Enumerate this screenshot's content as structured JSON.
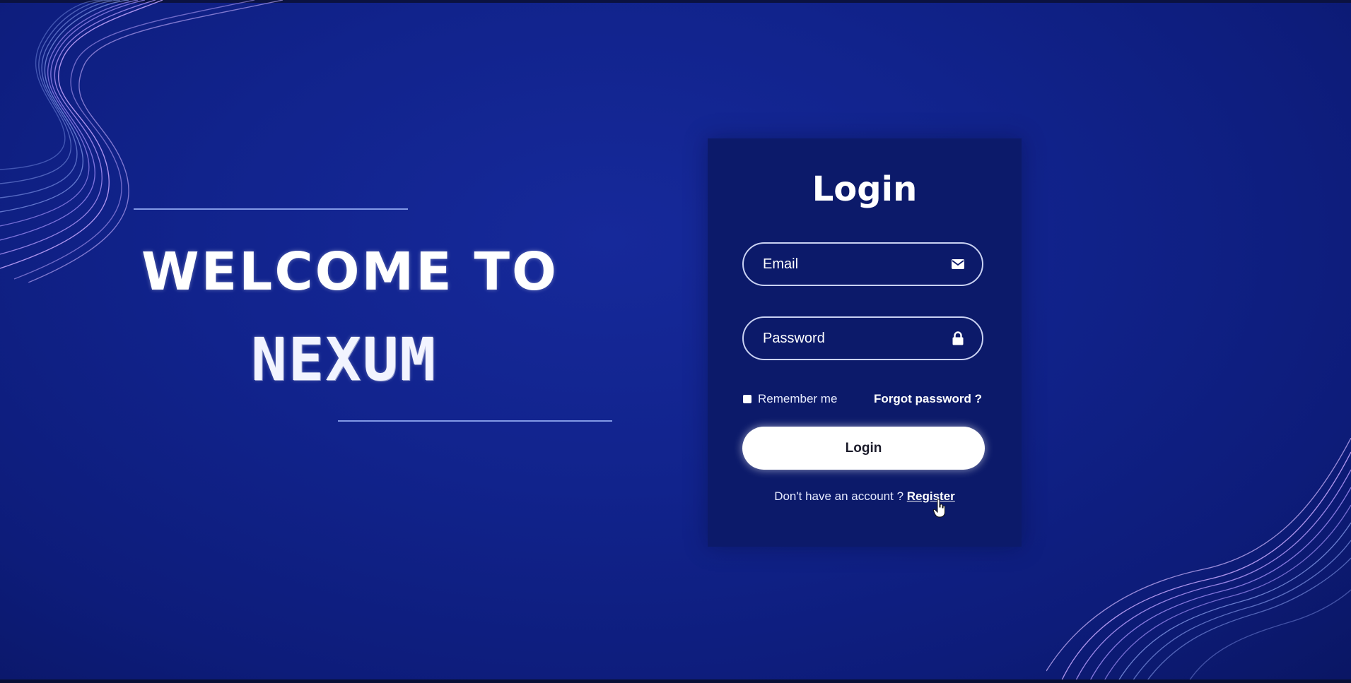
{
  "hero": {
    "line1": "WELCOME TO",
    "line2": "NEXUM"
  },
  "login_form": {
    "title": "Login",
    "email_placeholder": "Email",
    "email_icon": "envelope-icon",
    "password_placeholder": "Password",
    "password_icon": "lock-icon",
    "remember_label": "Remember me",
    "forgot_label": "Forgot password ?",
    "submit_label": "Login",
    "register_prompt": "Don't have an account ?",
    "register_link": "Register"
  },
  "colors": {
    "background": "#11238c",
    "card": "#0c1a6a",
    "accent_line": "#8fa6f0",
    "wave": "#b48cff",
    "button": "#ffffff"
  }
}
